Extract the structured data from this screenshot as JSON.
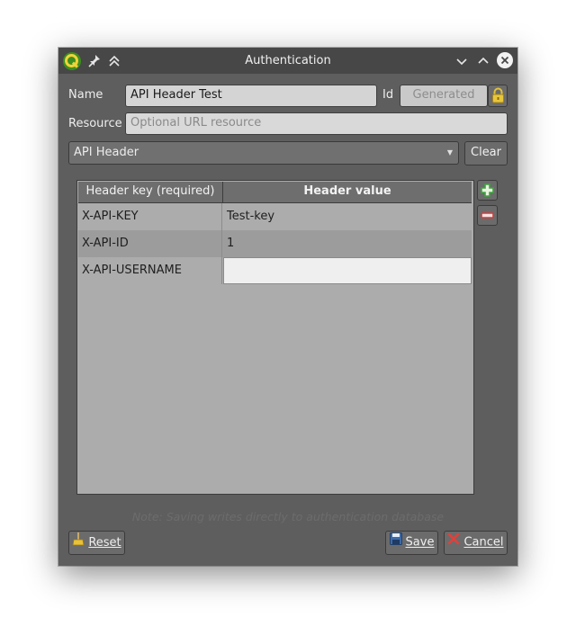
{
  "window": {
    "title": "Authentication"
  },
  "form": {
    "name_label": "Name",
    "name_value": "API Header Test",
    "id_label": "Id",
    "id_value": "Generated",
    "resource_label": "Resource",
    "resource_placeholder": "Optional URL resource",
    "method_selected": "API Header",
    "clear_label": "Clear"
  },
  "table": {
    "headers": [
      "Header key (required)",
      "Header value"
    ],
    "rows": [
      {
        "key": "X-API-KEY",
        "value": "Test-key"
      },
      {
        "key": "X-API-ID",
        "value": "1"
      },
      {
        "key": "X-API-USERNAME",
        "value": ""
      }
    ]
  },
  "footer": {
    "note": "Note: Saving writes directly to authentication database",
    "reset_label": "Reset",
    "save_label": "Save",
    "cancel_label": "Cancel"
  },
  "colors": {
    "window_bg": "#5e5e5e",
    "titlebar_bg": "#474747",
    "table_bg": "#acacac",
    "editing_cell_bg": "#efefef",
    "add_icon": "#3fa33f",
    "remove_icon": "#d23c3c"
  },
  "icons": [
    "qgis-logo-icon",
    "pin-icon",
    "keep-above-icon",
    "minimize-icon",
    "maximize-icon",
    "close-icon",
    "lock-icon",
    "add-icon",
    "remove-icon",
    "broom-icon",
    "save-icon",
    "cancel-icon",
    "dropdown-arrow-icon"
  ]
}
